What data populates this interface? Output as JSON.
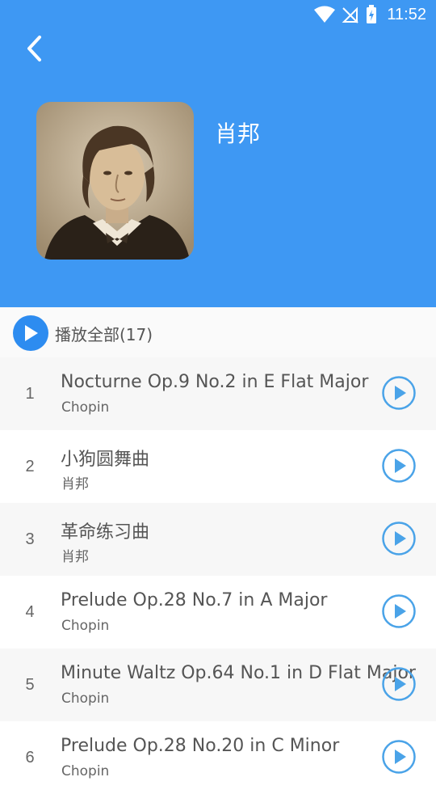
{
  "status_bar": {
    "time": "11:52"
  },
  "header": {
    "artist_name": "肖邦",
    "background_color": "#3e98f3",
    "back_icon": "chevron-left-icon"
  },
  "play_all": {
    "label": "播放全部(17)",
    "icon": "play-icon"
  },
  "tracks": [
    {
      "num": "1",
      "title": "Nocturne Op.9 No.2 in E Flat Major",
      "artist": "Chopin"
    },
    {
      "num": "2",
      "title": "小狗圆舞曲",
      "artist": "肖邦"
    },
    {
      "num": "3",
      "title": "革命练习曲",
      "artist": "肖邦"
    },
    {
      "num": "4",
      "title": "Prelude Op.28 No.7 in A Major",
      "artist": "Chopin"
    },
    {
      "num": "5",
      "title": "Minute Waltz Op.64 No.1 in D Flat Major",
      "artist": "Chopin"
    },
    {
      "num": "6",
      "title": "Prelude Op.28 No.20 in C Minor",
      "artist": "Chopin"
    }
  ]
}
